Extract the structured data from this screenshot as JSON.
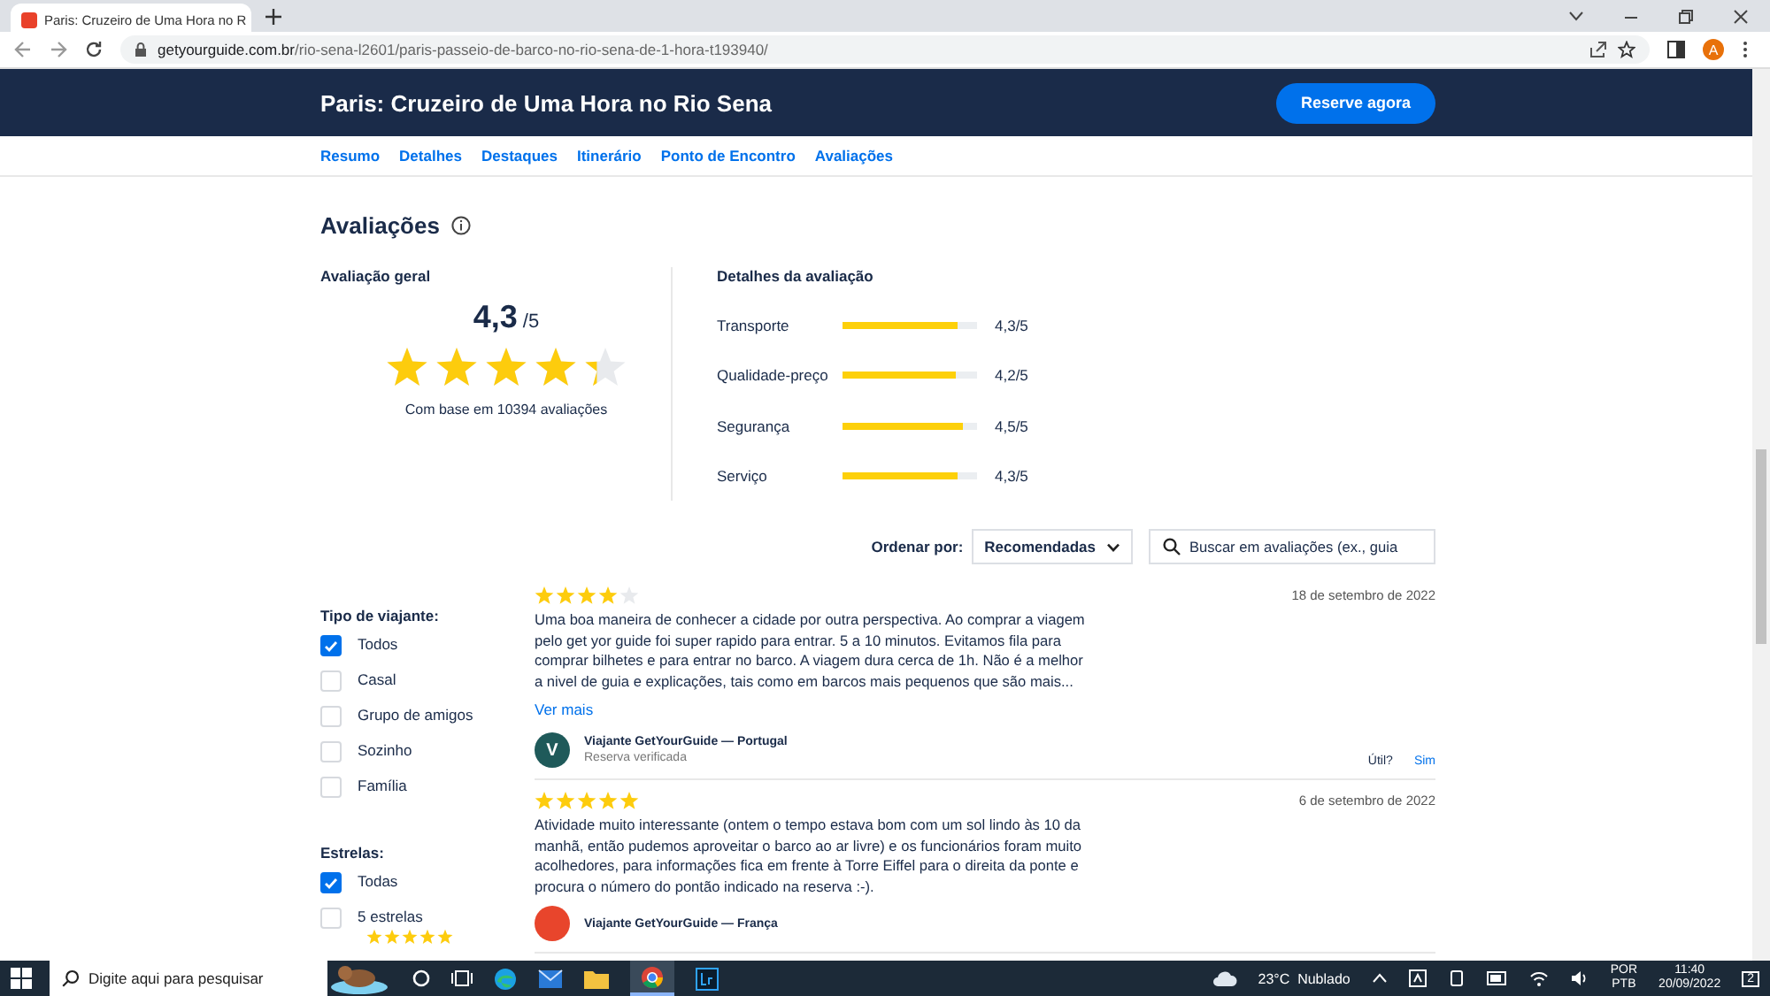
{
  "browser": {
    "tab_title": "Paris: Cruzeiro de Uma Hora no R",
    "url_host": "getyourguide.com.br",
    "url_path": "/rio-sena-l2601/paris-passeio-de-barco-no-rio-sena-de-1-hora-t193940/",
    "profile_initial": "A"
  },
  "header": {
    "title": "Paris: Cruzeiro de Uma Hora no Rio Sena",
    "book_button": "Reserve agora"
  },
  "subnav": [
    "Resumo",
    "Detalhes",
    "Destaques",
    "Itinerário",
    "Ponto de Encontro",
    "Avaliações"
  ],
  "reviews_heading": "Avaliações",
  "overall": {
    "label": "Avaliação geral",
    "score": "4,3",
    "out_of": "/5",
    "stars": 4.3,
    "based_on": "Com base em 10394 avaliações"
  },
  "details": {
    "label": "Detalhes da avaliação",
    "items": [
      {
        "name": "Transporte",
        "level": 0.86,
        "reading": "4,3/5"
      },
      {
        "name": "Qualidade-preço",
        "level": 0.84,
        "reading": "4,2/5"
      },
      {
        "name": "Segurança",
        "level": 0.9,
        "reading": "4,5/5"
      },
      {
        "name": "Serviço",
        "level": 0.86,
        "reading": "4,3/5"
      }
    ]
  },
  "sort": {
    "label": "Ordenar por:",
    "value": "Recomendadas",
    "search_placeholder": "Buscar em avaliações (ex., guia"
  },
  "filters": [
    {
      "title": "Tipo de viajante:",
      "options": [
        {
          "label": "Todos",
          "checked": true
        },
        {
          "label": "Casal",
          "checked": false
        },
        {
          "label": "Grupo de amigos",
          "checked": false
        },
        {
          "label": "Sozinho",
          "checked": false
        },
        {
          "label": "Família",
          "checked": false
        }
      ]
    },
    {
      "title": "Estrelas:",
      "options": [
        {
          "label": "Todas",
          "checked": true
        },
        {
          "label": "5 estrelas",
          "checked": false,
          "stars": 5
        }
      ]
    }
  ],
  "reviews": [
    {
      "stars": 4,
      "date": "18 de setembro de 2022",
      "text": "Uma boa maneira de conhecer a cidade por outra perspectiva. Ao comprar a viagem pelo get yor guide foi super rapido para entrar. 5 a 10 minutos. Evitamos fila para comprar bilhetes e para entrar no barco. A viagem dura cerca de 1h. Não é a melhor a nivel de guia e explicações, tais como em barcos mais pequenos que são mais...",
      "more": "Ver mais",
      "avatar": "V",
      "color": "#1f5a5a",
      "author": "Viajante GetYourGuide — Portugal",
      "verified": "Reserva verificada",
      "helpful": "Útil?",
      "helpful_yes": "Sim"
    },
    {
      "stars": 5,
      "date": "6 de setembro de 2022",
      "text": "Atividade muito interessante (ontem o tempo estava bom com um sol lindo às 10 da manhã, então pudemos aproveitar o barco ao ar livre) e os funcionários foram muito acolhedores, para informações fica em frente à Torre Eiffel para o direita da ponte e procura o número do pontão indicado na reserva :-).",
      "color": "#e8452c",
      "author": "Viajante GetYourGuide — França"
    }
  ],
  "taskbar": {
    "search_placeholder": "Digite aqui para pesquisar",
    "weather": "23°C  Nublado",
    "language": "POR",
    "layout": "PTB",
    "time": "11:40",
    "date": "20/09/2022",
    "notifications": "2"
  }
}
